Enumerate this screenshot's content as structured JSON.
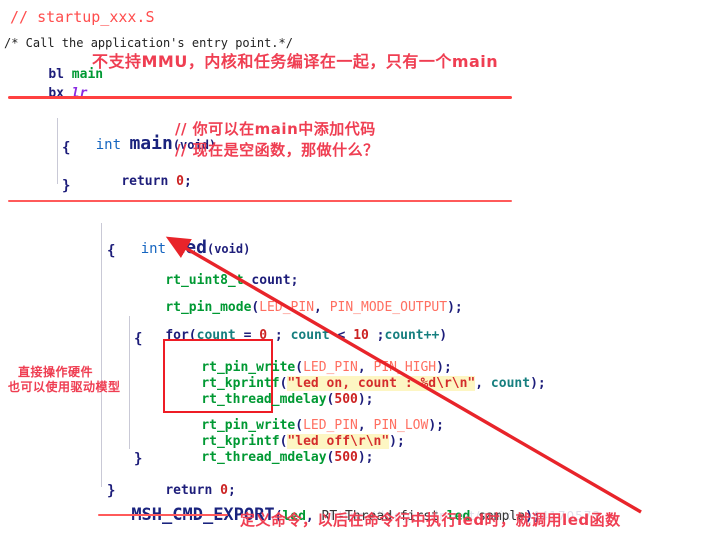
{
  "meta": {
    "accent_red": "#ff4040",
    "annotation_red": "#ef3e52",
    "highlight_box_red": "#ee1c25",
    "string_highlight": "#fdf6c3"
  },
  "watermark": {
    "text": "https://blog.csdn.net/weixin_44170573"
  },
  "section_startup": {
    "file_comment": "// startup_xxx.S",
    "block_comment": "/* Call the application's entry point.*/",
    "line_bl": {
      "op": "bl",
      "arg": "main"
    },
    "line_bx": {
      "op": "bx",
      "arg": "lr"
    },
    "annotation": "不支持MMU，内核和任务编译在一起，只有一个main"
  },
  "section_main": {
    "signature": {
      "type": "int",
      "name": "main",
      "args": "(void)"
    },
    "comment_1": "// 你可以在main中添加代码",
    "comment_2": "// 现在是空函数，那做什么？",
    "brace_open": "{",
    "return_stmt": {
      "kw": "return",
      "value": "0",
      "semi": ";"
    },
    "brace_close": "}"
  },
  "section_led": {
    "signature": {
      "type": "int",
      "name": "led",
      "args": "(void)"
    },
    "brace_open": "{",
    "decl": {
      "type": "rt_uint8_t",
      "name": "count",
      "semi": ";"
    },
    "pin_mode": {
      "fn": "rt_pin_mode",
      "open": "(",
      "arg1": "LED_PIN",
      "comma": ", ",
      "arg2": "PIN_MODE_OUTPUT",
      "close": ");"
    },
    "for_loop": {
      "kw": "for",
      "open": "(",
      "init_var": "count",
      "eq": " = ",
      "init_val": "0",
      "sep1": " ; ",
      "cond_var": "count",
      "lt": " < ",
      "limit": "10",
      "sep2": " ;",
      "inc": "count++",
      "close": ")"
    },
    "loop_brace_open": "{",
    "body": [
      {
        "fn": "rt_pin_write",
        "open": "(",
        "arg1": "LED_PIN",
        "comma": ", ",
        "arg2": "PIN_HIGH",
        "close": ");"
      },
      {
        "fn": "rt_kprintf",
        "open": "(",
        "string": "\"led on, count : %d\\r\\n\"",
        "comma": ", ",
        "arg2": "count",
        "close": ");"
      },
      {
        "fn": "rt_thread_mdelay",
        "open": "(",
        "num": "500",
        "close": ");"
      },
      {
        "fn": "rt_pin_write",
        "open": "(",
        "arg1": "LED_PIN",
        "comma": ", ",
        "arg2": "PIN_LOW",
        "close": ");"
      },
      {
        "fn": "rt_kprintf",
        "open": "(",
        "string": "\"led off\\r\\n\"",
        "close": ");"
      },
      {
        "fn": "rt_thread_mdelay",
        "open": "(",
        "num": "500",
        "close": ");"
      }
    ],
    "loop_brace_close": "}",
    "return_stmt": {
      "kw": "return",
      "value": "0",
      "semi": ";"
    },
    "brace_close": "}",
    "annotation_left_line1": "直接操作硬件",
    "annotation_left_line2": "也可以使用驱动模型"
  },
  "section_export": {
    "macro": "MSH_CMD_EXPORT",
    "open": "(",
    "cmd": "led",
    "comma1": ", ",
    "desc_pre": "RT-Thread first ",
    "desc_cmd": "led",
    "desc_post": " sample",
    "close": ");",
    "annotation": "定义命令，以后在命令行中执行led时，就调用led函数"
  }
}
